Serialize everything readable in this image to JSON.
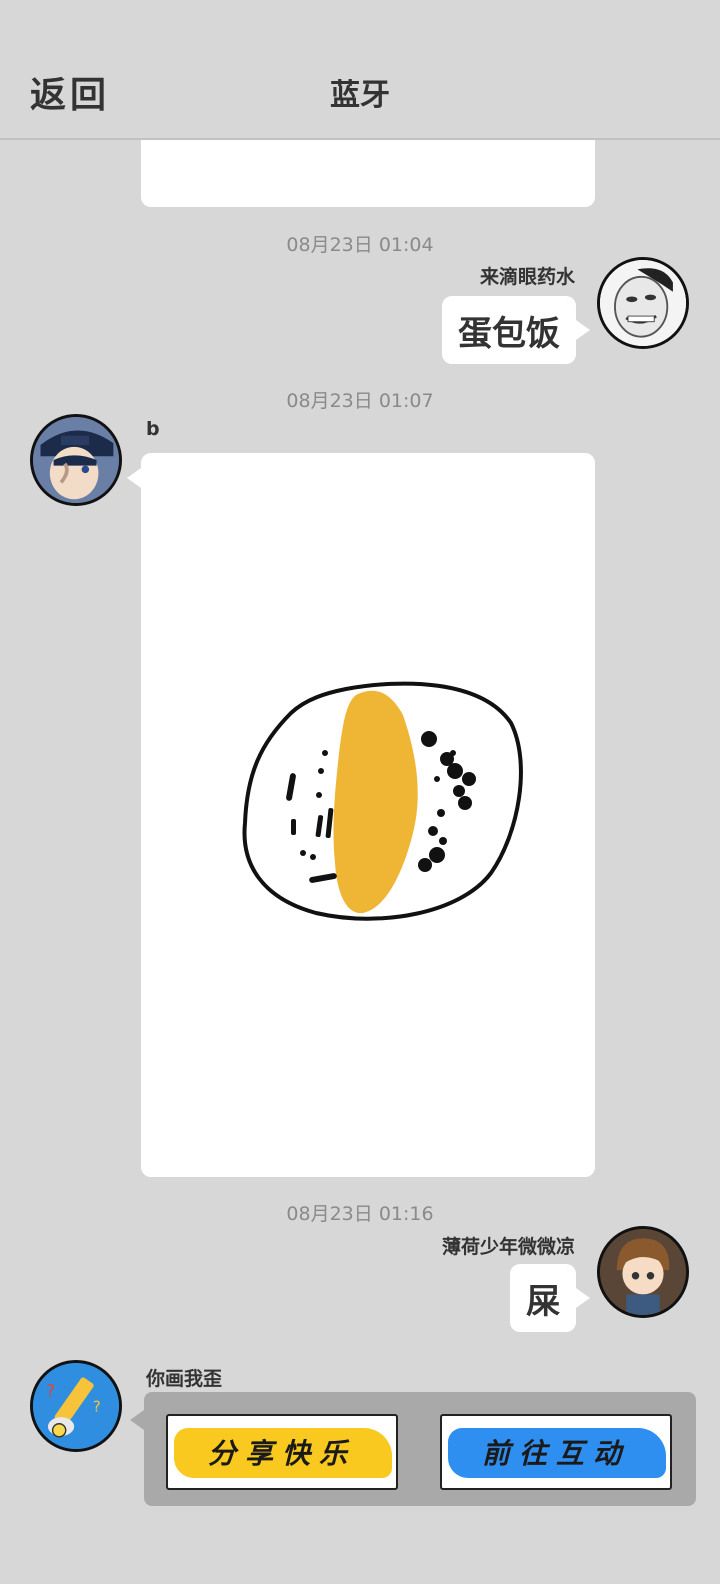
{
  "header": {
    "back_label": "返回",
    "title": "蓝牙"
  },
  "messages": [
    {
      "timestamp": "08月23日  01:04",
      "sender": "来滴眼药水",
      "text": "蛋包饭"
    },
    {
      "timestamp": "08月23日  01:07",
      "sender": "b",
      "image": "drawing-egg-fried-rice"
    },
    {
      "timestamp": "08月23日  01:16",
      "sender": "薄荷少年微微凉",
      "text": "屎"
    }
  ],
  "game_card": {
    "sender": "你画我歪",
    "share_label": "分享快乐",
    "interact_label": "前往互动",
    "colors": {
      "share": "#f9c91f",
      "interact": "#2f8ff0"
    }
  },
  "colors": {
    "background": "#d7d7d7",
    "egg": "#efb534"
  }
}
